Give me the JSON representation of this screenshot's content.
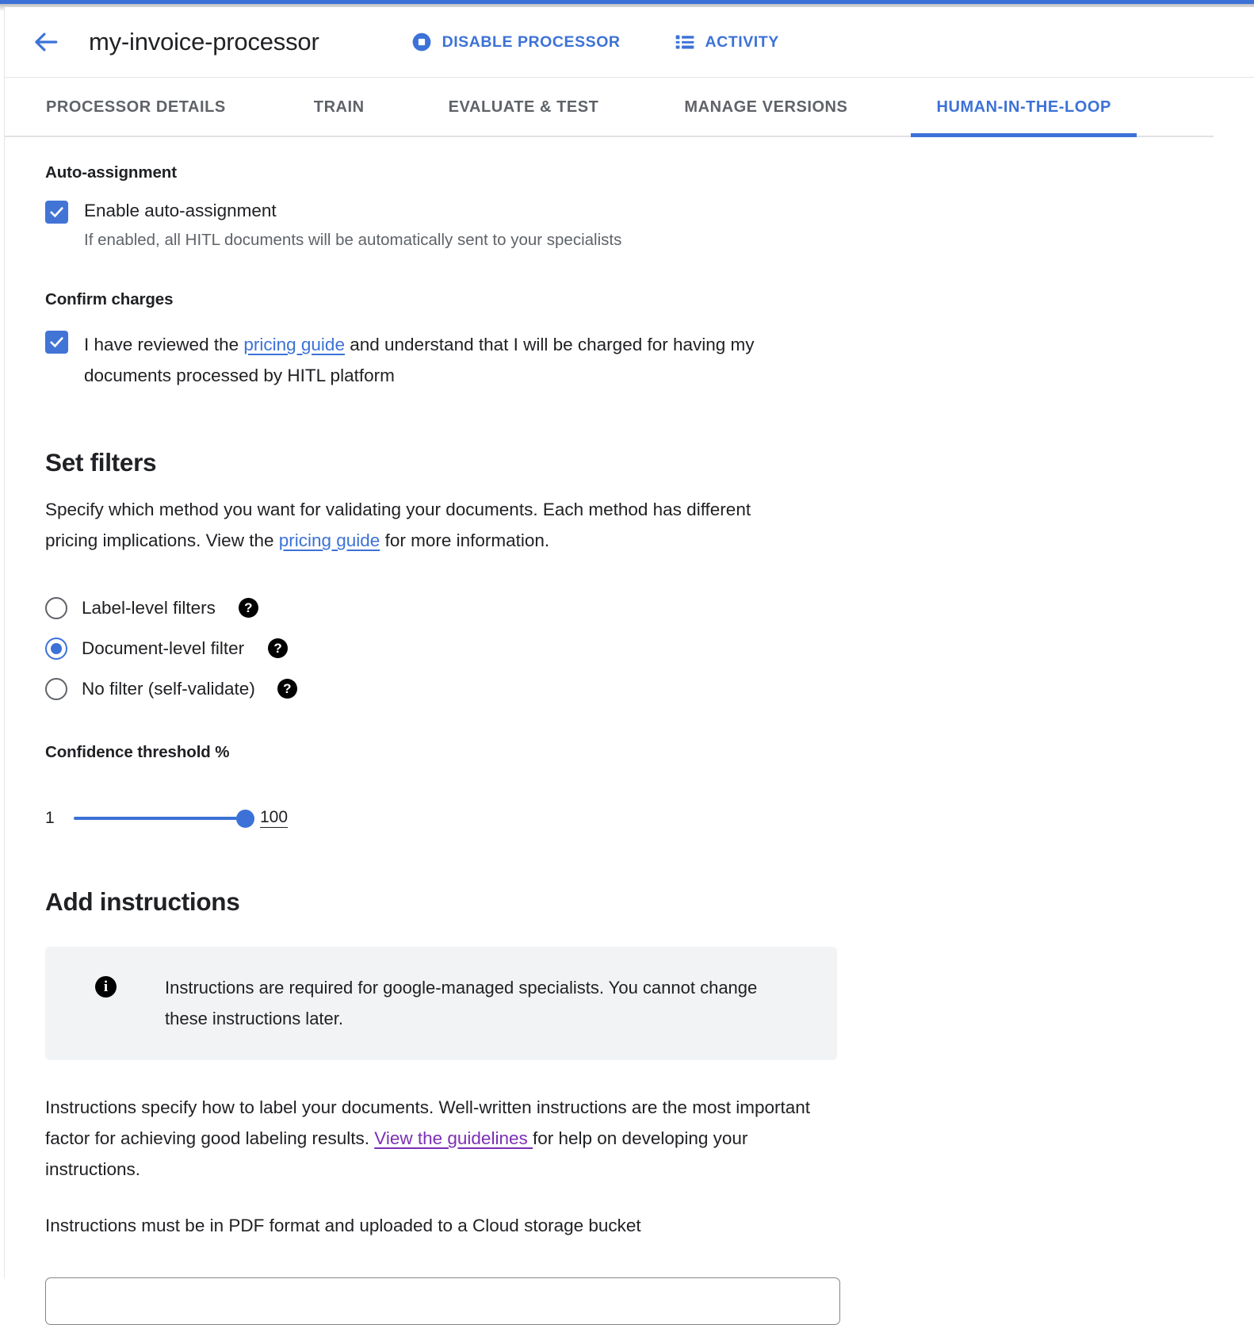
{
  "theme": {
    "accent_blue": "#3c72d7",
    "checkbox_blue": "#4274d6",
    "link_purple": "#7b2fb5",
    "muted_text": "#5f6368",
    "info_bg": "#f1f3f4",
    "border": "#e0e2e4"
  },
  "header": {
    "back_icon": "arrow-back-icon",
    "title": "my-invoice-processor",
    "actions": [
      {
        "label": "DISABLE PROCESSOR",
        "icon": "stop-circle-icon"
      },
      {
        "label": "ACTIVITY",
        "icon": "list-icon"
      }
    ]
  },
  "tabs": [
    {
      "label": "PROCESSOR DETAILS",
      "active": false
    },
    {
      "label": "TRAIN",
      "active": false
    },
    {
      "label": "EVALUATE & TEST",
      "active": false
    },
    {
      "label": "MANAGE VERSIONS",
      "active": false
    },
    {
      "label": "HUMAN-IN-THE-LOOP",
      "active": true
    }
  ],
  "auto_assignment": {
    "group_label": "Auto-assignment",
    "checkbox_label": "Enable auto-assignment",
    "checked": true,
    "helper_text": "If enabled, all HITL documents will be automatically sent to your specialists"
  },
  "confirm_charges": {
    "group_label": "Confirm charges",
    "checked": true,
    "text_before_link": "I have reviewed the ",
    "link_label": "pricing guide",
    "text_after_link": " and understand that I will be charged for having my documents processed by HITL platform"
  },
  "set_filters": {
    "heading": "Set filters",
    "desc_before_link": "Specify which method you want for validating your documents. Each method has different pricing implications. View the ",
    "desc_link_label": "pricing guide",
    "desc_after_link": " for more information.",
    "options": [
      {
        "label": "Label-level filters",
        "selected": false,
        "help_icon": "help-icon",
        "help_glyph": "?"
      },
      {
        "label": "Document-level filter",
        "selected": true,
        "help_icon": "help-icon",
        "help_glyph": "?"
      },
      {
        "label": "No filter (self-validate)",
        "selected": false,
        "help_icon": "help-icon",
        "help_glyph": "?"
      }
    ],
    "threshold": {
      "label": "Confidence threshold %",
      "min": "1",
      "max": 100,
      "value": "100"
    }
  },
  "add_instructions": {
    "heading": "Add instructions",
    "info_icon": "info-icon",
    "info_glyph": "i",
    "info_text": "Instructions are required for google-managed specialists. You cannot change these instructions later.",
    "para_before_link": "Instructions specify how to label your documents. Well-written instructions are the most important factor for achieving good labeling results. ",
    "para_link_label": "View the guidelines ",
    "para_after_link": "for help on developing your instructions.",
    "pdf_note": "Instructions must be in PDF format and uploaded to a Cloud storage bucket",
    "bucket_input_value": ""
  }
}
